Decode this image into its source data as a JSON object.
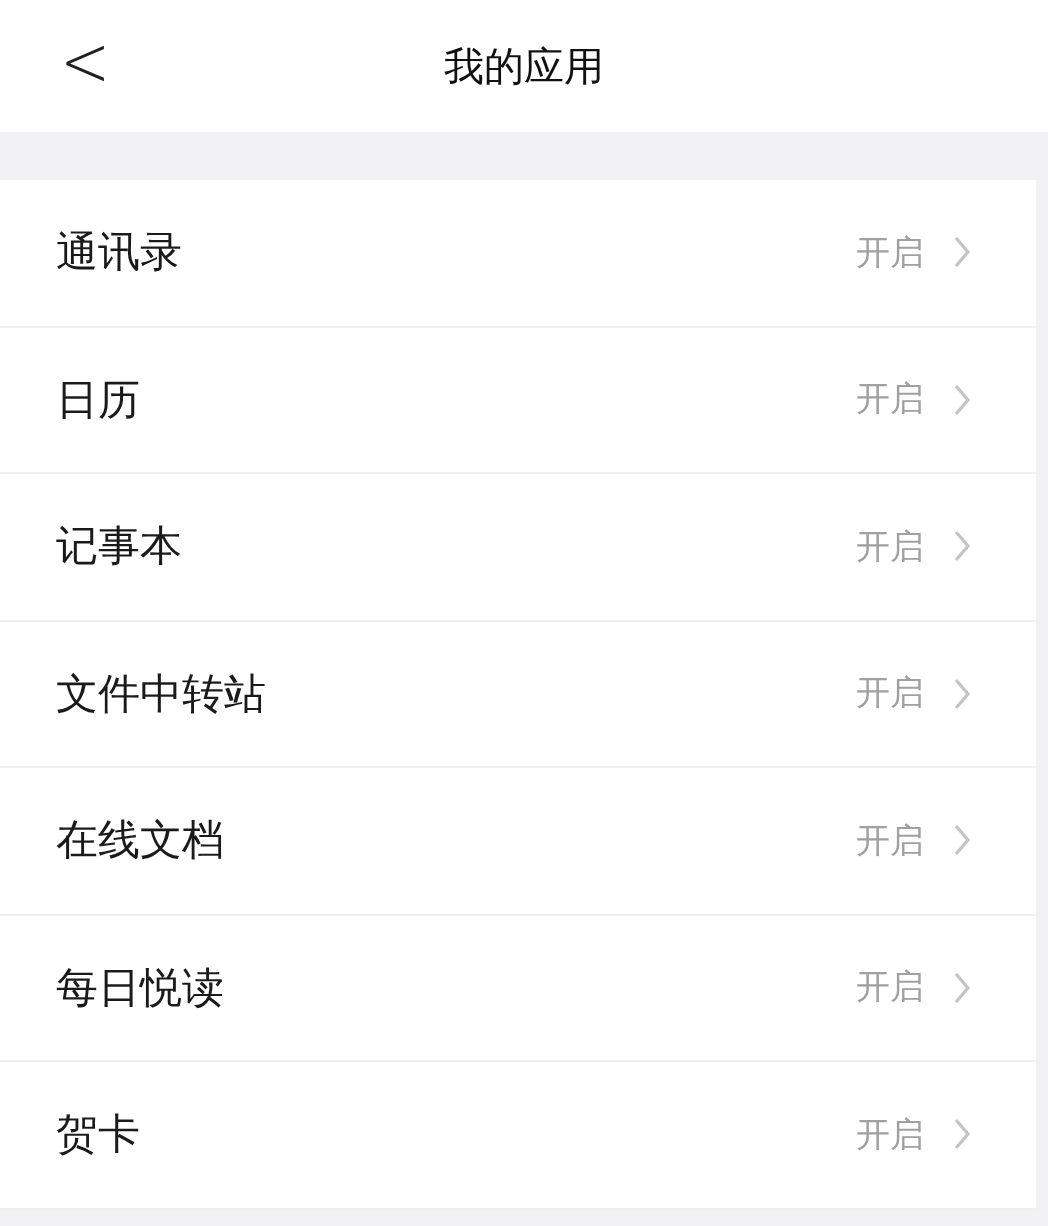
{
  "header": {
    "back": "<",
    "title": "我的应用"
  },
  "apps": [
    {
      "name": "通讯录",
      "status": "开启"
    },
    {
      "name": "日历",
      "status": "开启"
    },
    {
      "name": "记事本",
      "status": "开启"
    },
    {
      "name": "文件中转站",
      "status": "开启"
    },
    {
      "name": "在线文档",
      "status": "开启"
    },
    {
      "name": "每日悦读",
      "status": "开启"
    },
    {
      "name": "贺卡",
      "status": "开启"
    }
  ]
}
